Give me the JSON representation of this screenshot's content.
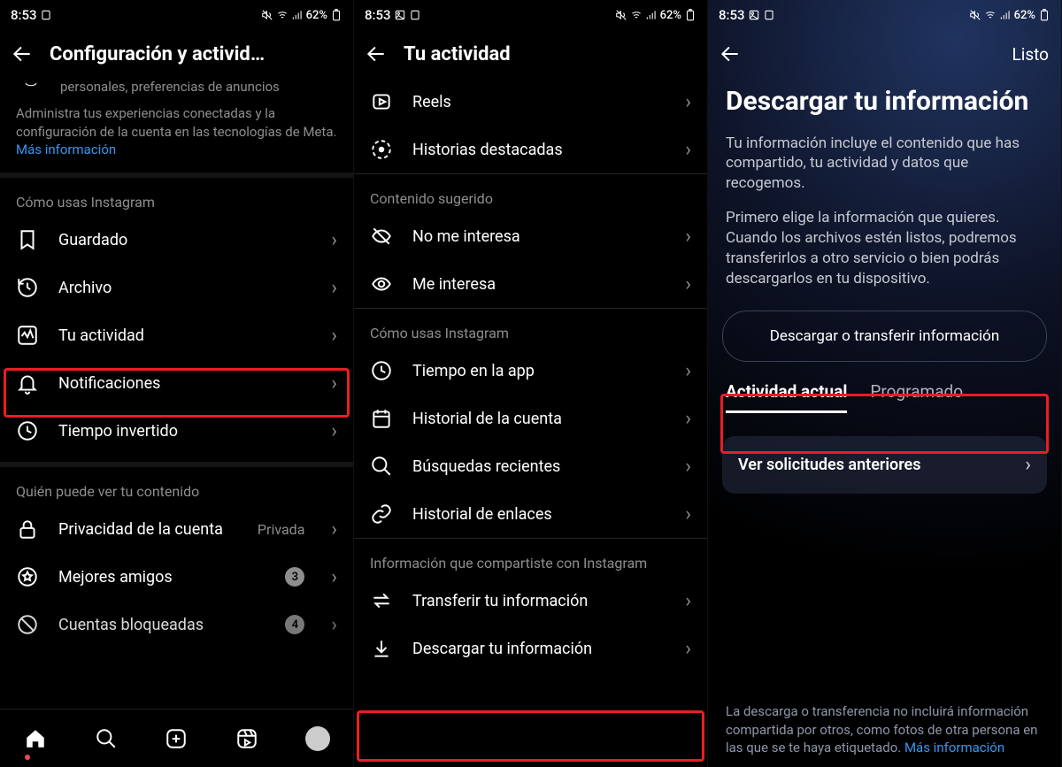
{
  "status": {
    "time": "8:53",
    "battery": "62%"
  },
  "panel1": {
    "title": "Configuración y activid…",
    "topPara": "personales, preferencias de anuncios",
    "metaPara": "Administra tus experiencias conectadas y la configuración de la cuenta en las tecnologías de Meta.",
    "moreInfo": "Más información",
    "sectionUse": "Cómo usas Instagram",
    "rows": {
      "saved": "Guardado",
      "archive": "Archivo",
      "activity": "Tu actividad",
      "notifications": "Notificaciones",
      "timeSpent": "Tiempo invertido"
    },
    "sectionWho": "Quién puede ver tu contenido",
    "privacy": "Privacidad de la cuenta",
    "privacyTrailing": "Privada",
    "bestFriends": "Mejores amigos",
    "bestFriendsBadge": "3",
    "blocked": "Cuentas bloqueadas",
    "blockedBadge": "4"
  },
  "panel2": {
    "title": "Tu actividad",
    "rowsTop": {
      "reels": "Reels",
      "highlights": "Historias destacadas"
    },
    "sectionSuggested": "Contenido sugerido",
    "suggested": {
      "notInterested": "No me interesa",
      "interested": "Me interesa"
    },
    "sectionUse": "Cómo usas Instagram",
    "usage": {
      "timeApp": "Tiempo en la app",
      "history": "Historial de la cuenta",
      "searches": "Búsquedas recientes",
      "links": "Historial de enlaces"
    },
    "sectionShare": "Información que compartiste con Instagram",
    "share": {
      "transfer": "Transferir tu información",
      "download": "Descargar tu información"
    }
  },
  "panel3": {
    "done": "Listo",
    "heading": "Descargar tu información",
    "para1": "Tu información incluye el contenido que has compartido, tu actividad y datos que recogemos.",
    "para2": "Primero elige la información que quieres. Cuando los archivos estén listos, podremos transferirlos a otro servicio o bien podrás descargarlos en tu dispositivo.",
    "button": "Descargar o transferir información",
    "tabActive": "Actividad actual",
    "tabScheduled": "Programado",
    "card": "Ver solicitudes anteriores",
    "footer": "La descarga o transferencia no incluirá información compartida por otros, como fotos de otra persona en las que se te haya etiquetado.",
    "footerLink": "Más información"
  }
}
